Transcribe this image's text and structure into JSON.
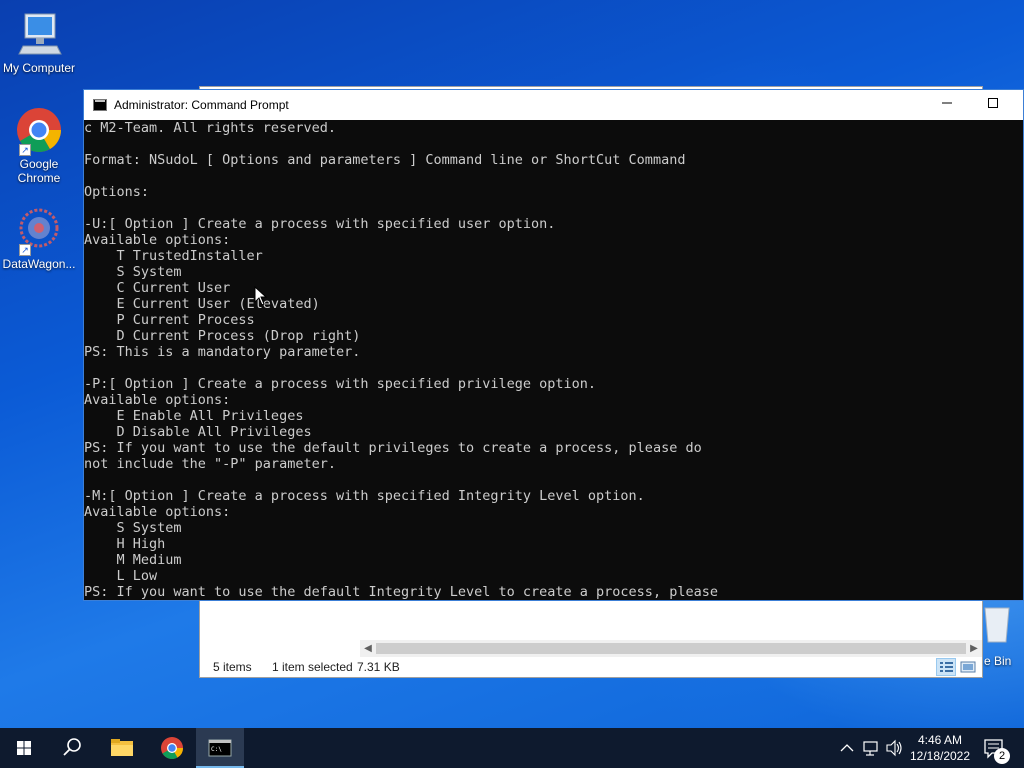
{
  "desktop": {
    "icons": [
      {
        "label": "My Computer"
      },
      {
        "label": "Google Chrome"
      },
      {
        "label": "DataWagon..."
      },
      {
        "label": "e Bin"
      }
    ]
  },
  "explorer": {
    "status_items": "5 items",
    "status_selected": "1 item selected",
    "status_size": "7.31 KB"
  },
  "cmd": {
    "title": "Administrator: Command Prompt",
    "lines": [
      "c M2-Team. All rights reserved.",
      "",
      "Format: NSudoL [ Options and parameters ] Command line or ShortCut Command",
      "",
      "Options:",
      "",
      "-U:[ Option ] Create a process with specified user option.",
      "Available options:",
      "    T TrustedInstaller",
      "    S System",
      "    C Current User",
      "    E Current User (Elevated)",
      "    P Current Process",
      "    D Current Process (Drop right)",
      "PS: This is a mandatory parameter.",
      "",
      "-P:[ Option ] Create a process with specified privilege option.",
      "Available options:",
      "    E Enable All Privileges",
      "    D Disable All Privileges",
      "PS: If you want to use the default privileges to create a process, please do",
      "not include the \"-P\" parameter.",
      "",
      "-M:[ Option ] Create a process with specified Integrity Level option.",
      "Available options:",
      "    S System",
      "    H High",
      "    M Medium",
      "    L Low",
      "PS: If you want to use the default Integrity Level to create a process, please"
    ]
  },
  "taskbar": {
    "time": "4:46 AM",
    "date": "12/18/2022",
    "notification_count": "2"
  },
  "colors": {
    "console_bg": "#0c0c0c",
    "console_text": "#cccccc",
    "taskbar_bg": "#0e1a2e",
    "accent": "#76b9ed"
  }
}
